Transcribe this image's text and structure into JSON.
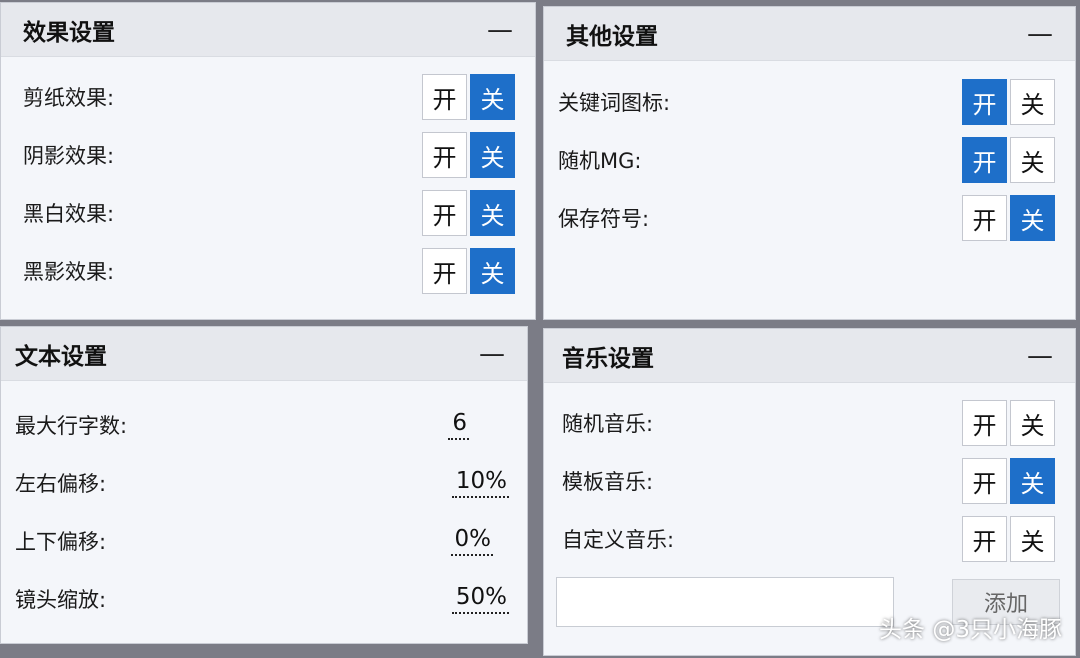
{
  "panels": {
    "effects": {
      "title": "效果设置",
      "collapse": "—",
      "rows": [
        {
          "label": "剪纸效果:",
          "on": "开",
          "off": "关",
          "state": "off"
        },
        {
          "label": "阴影效果:",
          "on": "开",
          "off": "关",
          "state": "off"
        },
        {
          "label": "黑白效果:",
          "on": "开",
          "off": "关",
          "state": "off"
        },
        {
          "label": "黑影效果:",
          "on": "开",
          "off": "关",
          "state": "off"
        }
      ]
    },
    "other": {
      "title": "其他设置",
      "collapse": "—",
      "rows": [
        {
          "label": "关键词图标:",
          "on": "开",
          "off": "关",
          "state": "on"
        },
        {
          "label": "随机MG:",
          "on": "开",
          "off": "关",
          "state": "on"
        },
        {
          "label": "保存符号:",
          "on": "开",
          "off": "关",
          "state": "off"
        }
      ]
    },
    "text": {
      "title": "文本设置",
      "collapse": "—",
      "rows": [
        {
          "label": "最大行字数:",
          "value": "6"
        },
        {
          "label": "左右偏移:",
          "value": "10%"
        },
        {
          "label": "上下偏移:",
          "value": "0%"
        },
        {
          "label": "镜头缩放:",
          "value": "50%"
        }
      ]
    },
    "music": {
      "title": "音乐设置",
      "collapse": "—",
      "rows": [
        {
          "label": "随机音乐:",
          "on": "开",
          "off": "关",
          "state": "none"
        },
        {
          "label": "模板音乐:",
          "on": "开",
          "off": "关",
          "state": "off"
        },
        {
          "label": "自定义音乐:",
          "on": "开",
          "off": "关",
          "state": "none"
        }
      ],
      "add_button": "添加"
    }
  },
  "watermark": "头条 @3只小海豚",
  "colors": {
    "accent": "#1e6fc9",
    "background": "#7b7c86",
    "panel": "#f4f6fa",
    "header": "#e6e8ed"
  }
}
